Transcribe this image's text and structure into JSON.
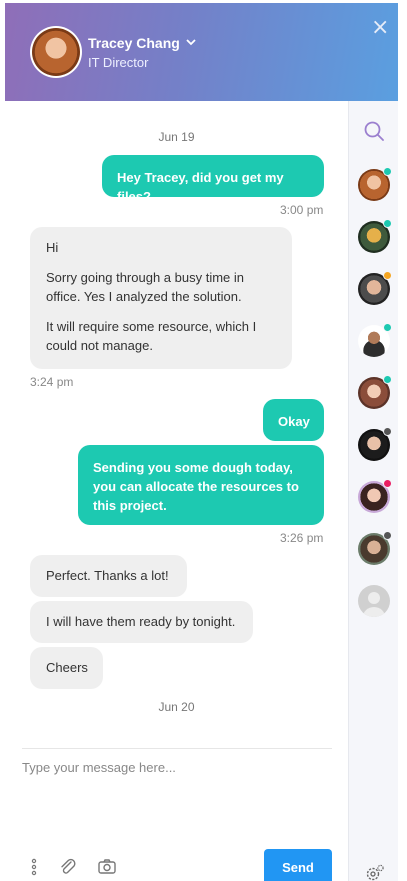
{
  "header": {
    "name": "Tracey Chang",
    "role": "IT Director",
    "close_symbol": "×"
  },
  "conversation": {
    "date_1": "Jun 19",
    "msg_1": "Hey Tracey, did you get my files?",
    "time_1": "3:00 pm",
    "msg_2_lines": [
      "Hi",
      "Sorry going through a busy time in office. Yes I analyzed the solution.",
      "It will require some resource, which I could not manage."
    ],
    "time_2": "3:24 pm",
    "msg_3": "Okay",
    "msg_4": "Sending you some dough today, you can allocate the resources to this project.",
    "time_3": "3:26 pm",
    "msg_5": "Perfect. Thanks a lot!",
    "msg_6": "I will have them ready by tonight.",
    "msg_7": "Cheers",
    "date_2": "Jun 20"
  },
  "composer": {
    "placeholder": "Type your message here...",
    "send_label": "Send"
  },
  "sidebar": {
    "contacts": [
      {
        "icon": "contact-avatar-1",
        "status_color": "#1dc9b1"
      },
      {
        "icon": "contact-avatar-2",
        "status_color": "#1dc9b1"
      },
      {
        "icon": "contact-avatar-3",
        "status_color": "#f5a623"
      },
      {
        "icon": "contact-avatar-4",
        "status_color": "#1dc9b1"
      },
      {
        "icon": "contact-avatar-5",
        "status_color": "#1dc9b1"
      },
      {
        "icon": "contact-avatar-6",
        "status_color": "#555555"
      },
      {
        "icon": "contact-avatar-7",
        "status_color": "#e91e63"
      },
      {
        "icon": "contact-avatar-8",
        "status_color": "#555555"
      },
      {
        "icon": "contact-avatar-placeholder",
        "status_color": ""
      }
    ]
  },
  "colors": {
    "accent": "#1dc9b1",
    "send": "#2196f3",
    "header_gradient": [
      "#8f6eb8",
      "#5a9fe0"
    ]
  }
}
